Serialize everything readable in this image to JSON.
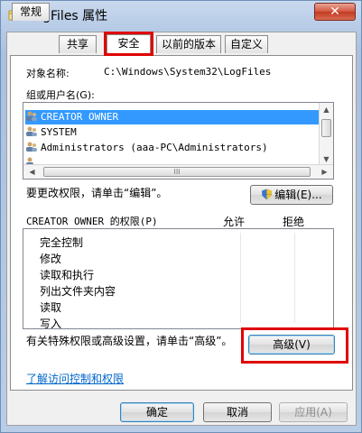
{
  "window": {
    "title": "LogFiles 属性",
    "close_label": "✕"
  },
  "tabs": [
    {
      "label": "常规"
    },
    {
      "label": "共享"
    },
    {
      "label": "安全",
      "active": true
    },
    {
      "label": "以前的版本"
    },
    {
      "label": "自定义"
    }
  ],
  "security": {
    "object_name_label": "对象名称:",
    "object_name_value": "C:\\Windows\\System32\\LogFiles",
    "group_users_label": "组或用户名(G):",
    "users": [
      {
        "name": "CREATOR OWNER",
        "selected": true
      },
      {
        "name": "SYSTEM",
        "selected": false
      },
      {
        "name": "Administrators (aaa-PC\\Administrators)",
        "selected": false
      }
    ],
    "scroll_thumb_grip": "III",
    "change_perm_text": "要更改权限，请单击“编辑”。",
    "edit_button": "编辑(E)...",
    "perm_title": "CREATOR OWNER 的权限(P)",
    "allow_header": "允许",
    "deny_header": "拒绝",
    "permissions": [
      {
        "label": "完全控制"
      },
      {
        "label": "修改"
      },
      {
        "label": "读取和执行"
      },
      {
        "label": "列出文件夹内容"
      },
      {
        "label": "读取"
      },
      {
        "label": "写入"
      }
    ],
    "advanced_text": "有关特殊权限或高级设置，请单击“高级”。",
    "advanced_button": "高级(V)",
    "learn_link": "了解访问控制和权限"
  },
  "footer": {
    "ok": "确定",
    "cancel": "取消",
    "apply": "应用(A)"
  },
  "colors": {
    "highlight_box": "#e00000",
    "selection": "#3399ff",
    "link": "#0066cc"
  }
}
